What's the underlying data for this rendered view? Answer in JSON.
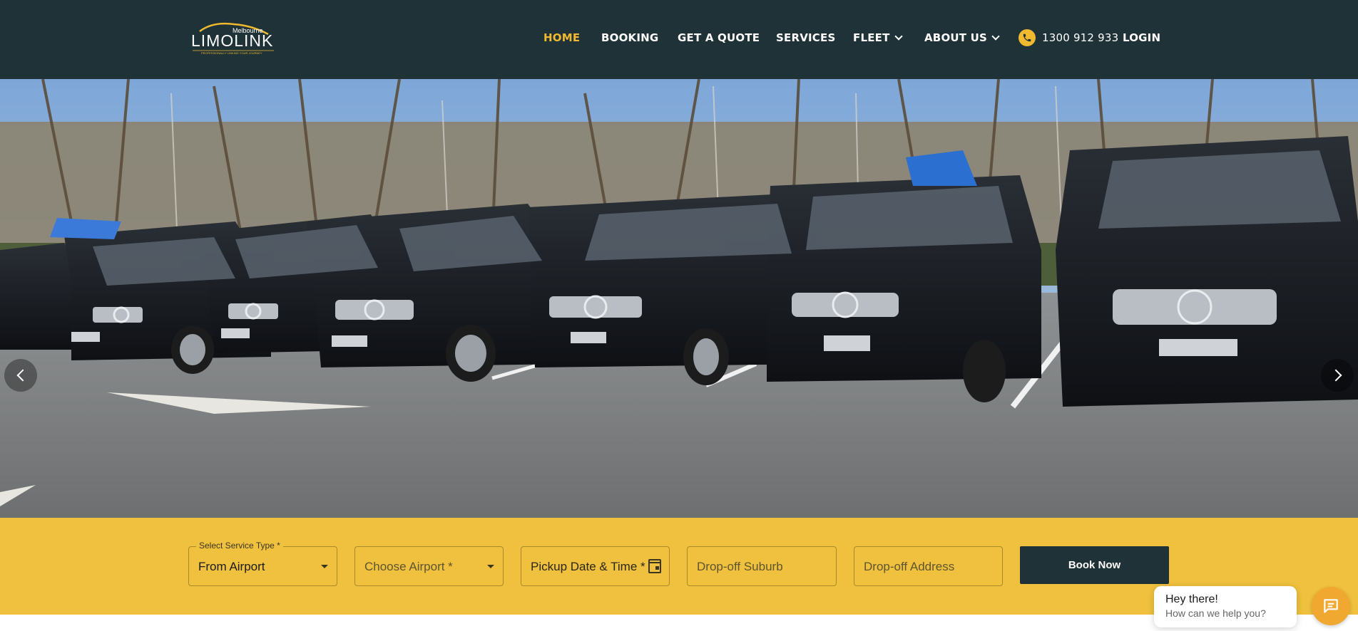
{
  "brand": {
    "logo_top": "Melbourne",
    "logo_main": "LIMOLINK",
    "logo_tagline": "PROFESSIONALLY LINKING YOUR JOURNEY",
    "accent_color": "#f0b92f",
    "header_color": "#1e3237",
    "booking_bar_color": "#f0c13e"
  },
  "nav": {
    "home": "HOME",
    "booking": "BOOKING",
    "quote": "GET A QUOTE",
    "services": "SERVICES",
    "fleet": "FLEET",
    "about": "ABOUT US",
    "phone": "1300 912 933",
    "login": "LOGIN"
  },
  "booking_form": {
    "service_type_label": "Select Service Type *",
    "service_type_value": "From Airport",
    "airport_placeholder": "Choose Airport *",
    "pickup_placeholder": "Pickup Date & Time *",
    "suburb_placeholder": "Drop-off Suburb",
    "address_placeholder": "Drop-off Address",
    "submit_label": "Book Now"
  },
  "chat": {
    "title": "Hey there!",
    "subtitle": "How can we help you?"
  },
  "icons": {
    "phone": "phone-icon",
    "chat": "chat-icon",
    "calendar": "calendar-icon",
    "prev": "chevron-left-icon",
    "next": "chevron-right-icon"
  }
}
